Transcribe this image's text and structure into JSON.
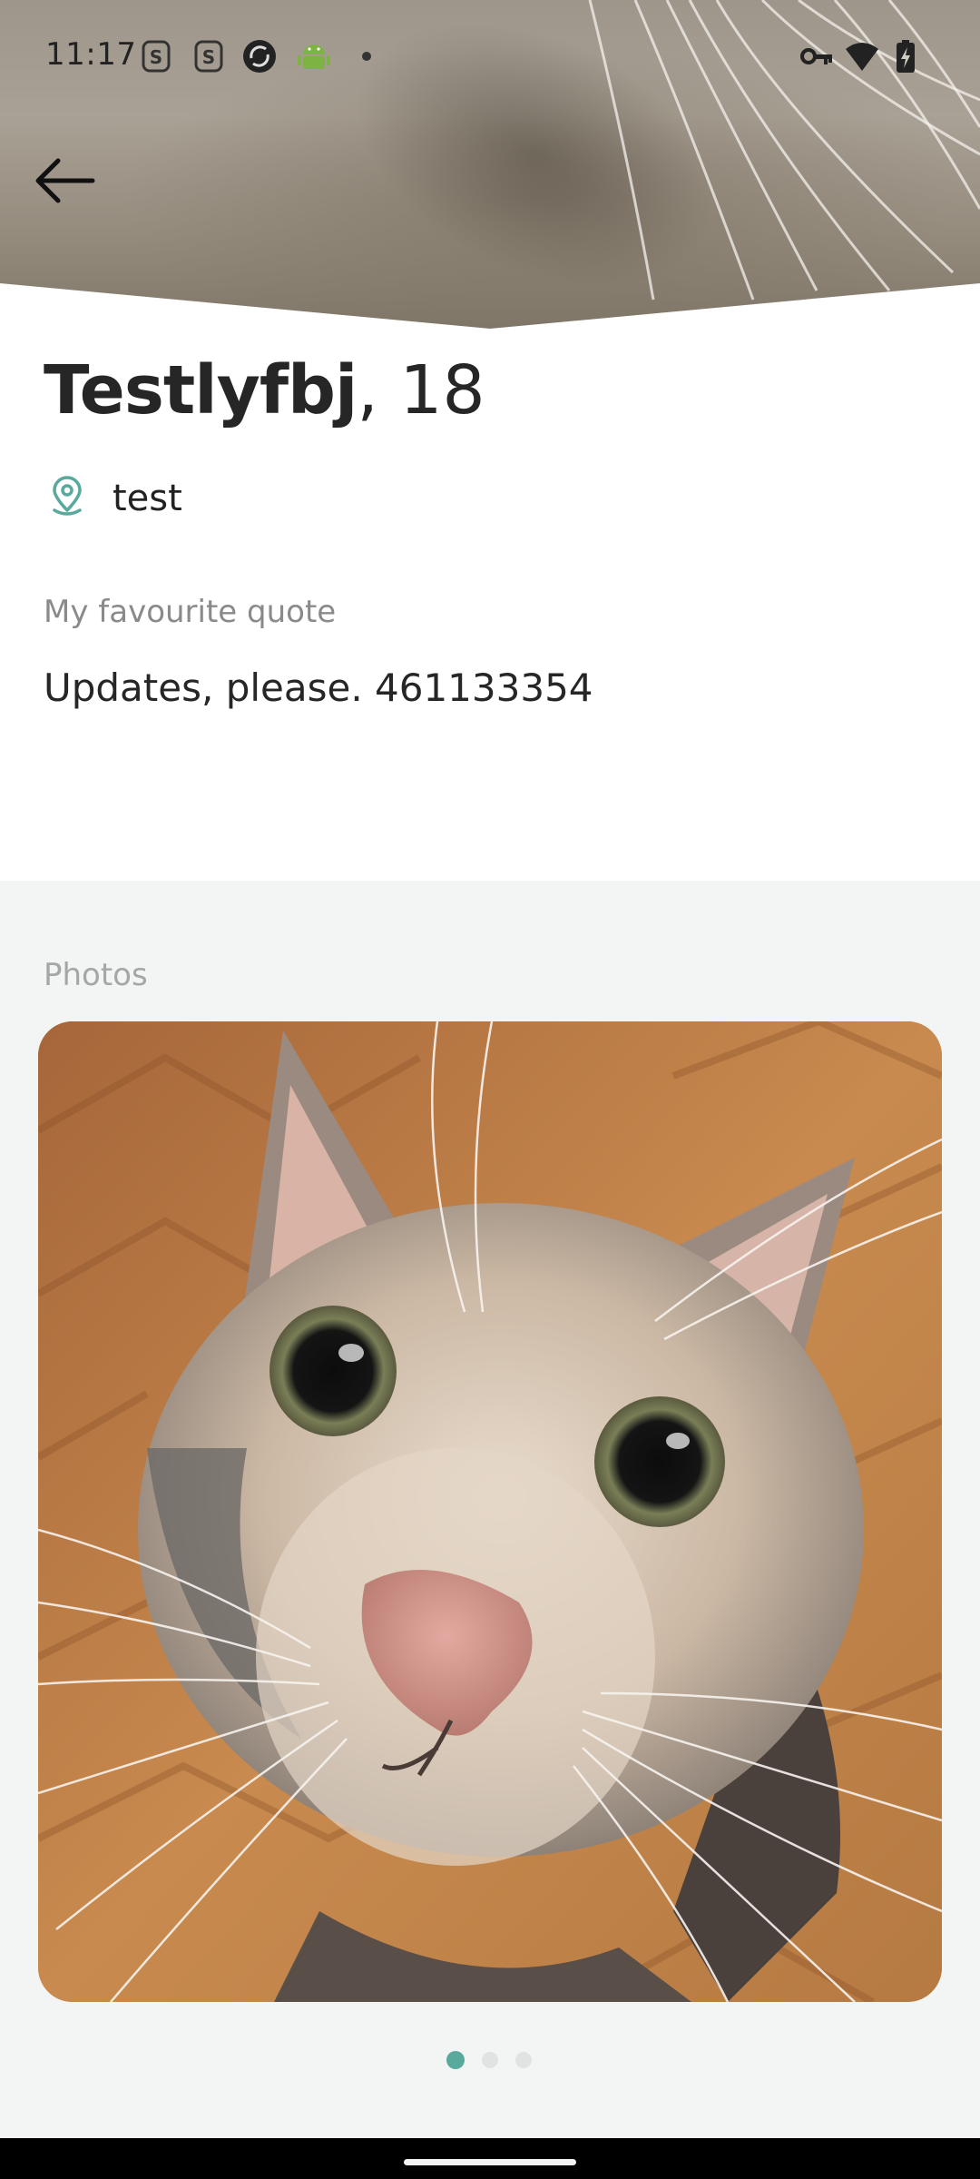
{
  "status_bar": {
    "time": "11:17",
    "icons": [
      "sim-s-icon",
      "sim-s-icon",
      "sync-icon",
      "android-icon",
      "dot-icon",
      "vpn-key-icon",
      "wifi-icon",
      "battery-icon"
    ]
  },
  "header": {
    "back_icon": "arrow-left-icon"
  },
  "profile": {
    "name": "Testlyfbj",
    "age_suffix": ", 18",
    "location_icon": "location-pin-icon",
    "location": "test",
    "quote_label": "My favourite quote",
    "quote": "Updates, please. 461133354"
  },
  "photos": {
    "label": "Photos",
    "total": 3,
    "current_index": 0
  },
  "colors": {
    "accent": "#5aa99d",
    "section_bg": "#f2f5f4",
    "muted_text": "#8a8a8a"
  }
}
